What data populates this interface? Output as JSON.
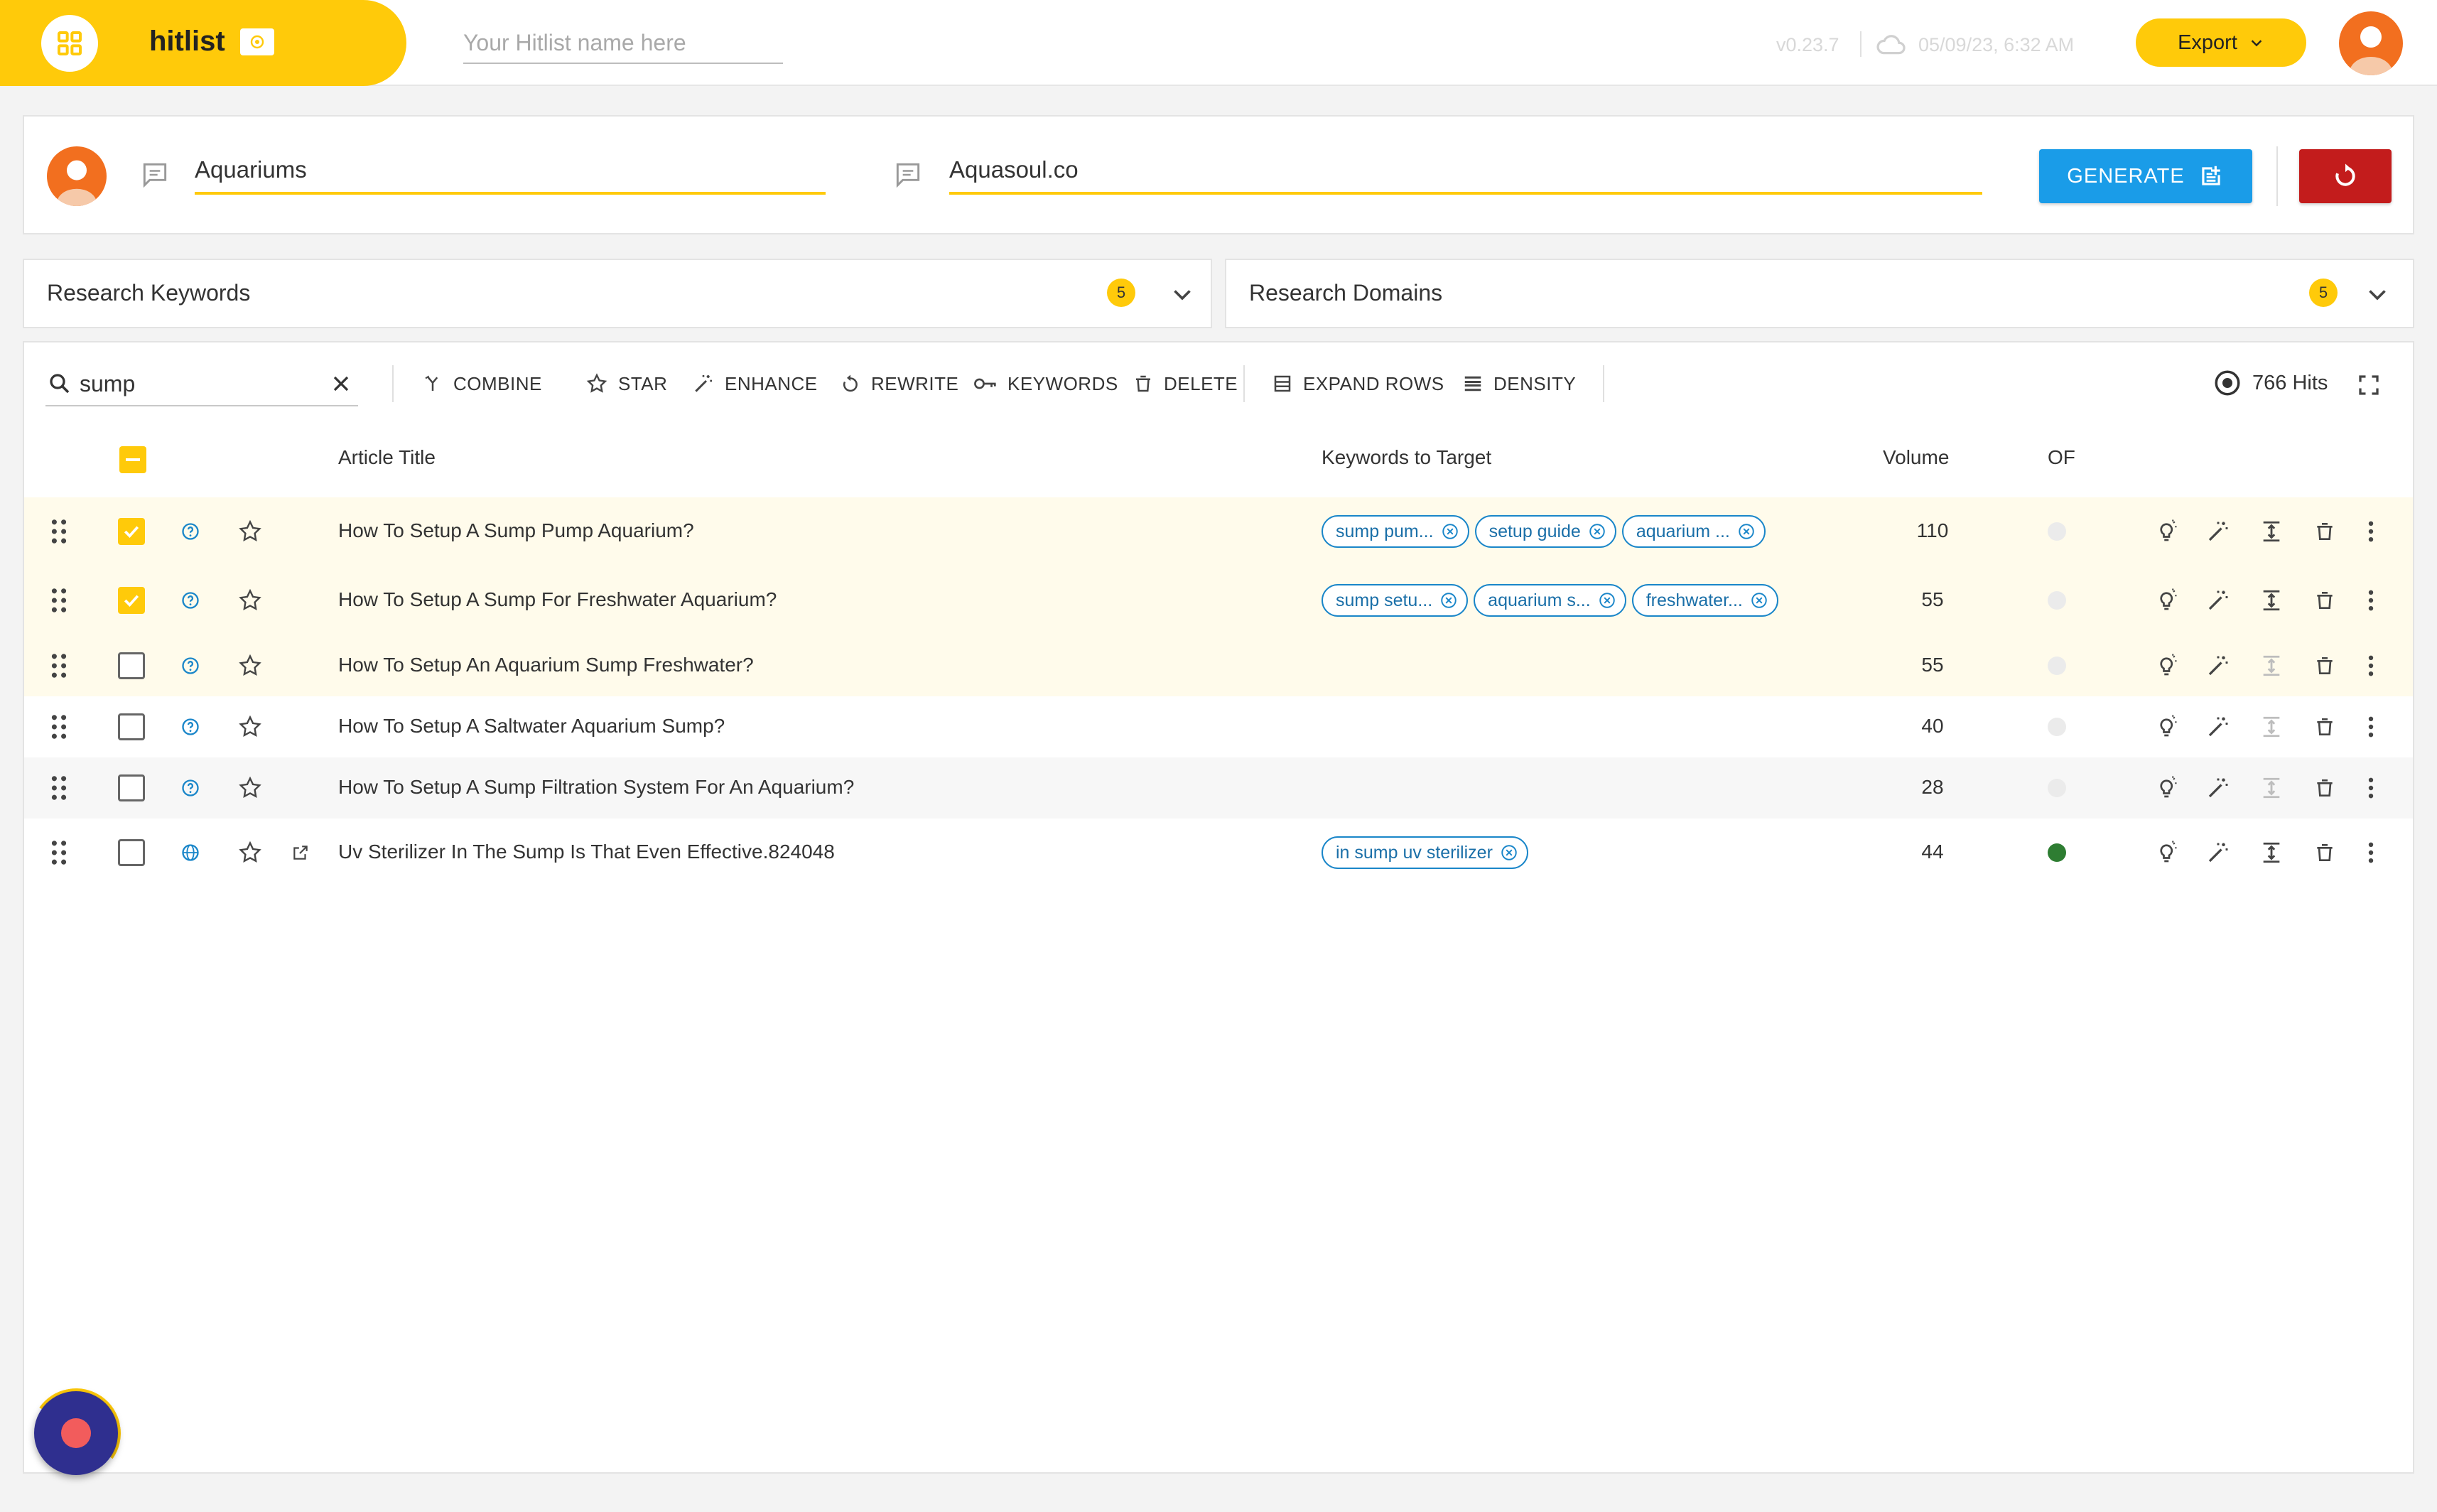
{
  "app": {
    "brand": "hitlist",
    "hitlist_name_placeholder": "Your Hitlist name here",
    "version": "v0.23.7",
    "saved_at": "05/09/23, 6:32 AM",
    "export_label": "Export"
  },
  "inputs": {
    "topic": "Aquariums",
    "domain": "Aquasoul.co",
    "generate_label": "GENERATE"
  },
  "panels": {
    "keywords": {
      "title": "Research Keywords",
      "count": "5"
    },
    "domains": {
      "title": "Research Domains",
      "count": "5"
    }
  },
  "toolbar": {
    "search_value": "sump",
    "combine": "COMBINE",
    "star": "STAR",
    "enhance": "ENHANCE",
    "rewrite": "REWRITE",
    "keywords": "KEYWORDS",
    "delete": "DELETE",
    "expand_rows": "EXPAND ROWS",
    "density": "DENSITY",
    "hits": "766 Hits"
  },
  "table": {
    "headers": {
      "title": "Article Title",
      "keywords": "Keywords to Target",
      "volume": "Volume",
      "of": "OF"
    },
    "rows": [
      {
        "title": "How To Setup A Sump Pump Aquarium?",
        "checked": true,
        "icon": "question-icon",
        "keywords": [
          "sump pum...",
          "setup guide",
          "aquarium ..."
        ],
        "volume": "110",
        "of": false
      },
      {
        "title": "How To Setup A Sump For Freshwater Aquarium?",
        "checked": true,
        "icon": "question-icon",
        "keywords": [
          "sump setu...",
          "aquarium s...",
          "freshwater..."
        ],
        "volume": "55",
        "of": false
      },
      {
        "title": "How To Setup An Aquarium Sump Freshwater?",
        "checked": false,
        "icon": "question-icon",
        "keywords": [],
        "volume": "55",
        "of": false
      },
      {
        "title": "How To Setup A Saltwater Aquarium Sump?",
        "checked": false,
        "icon": "question-icon",
        "keywords": [],
        "volume": "40",
        "of": false
      },
      {
        "title": "How To Setup A Sump Filtration System For An Aquarium?",
        "checked": false,
        "icon": "question-icon",
        "keywords": [],
        "volume": "28",
        "of": false
      },
      {
        "title": "Uv Sterilizer In The Sump Is That Even Effective.824048",
        "checked": false,
        "icon": "globe-icon",
        "keywords": [
          "in sump uv sterilizer"
        ],
        "volume": "44",
        "of": true
      }
    ]
  },
  "colors": {
    "brand_yellow": "#FFCA0A",
    "generate_blue": "#1A9CE8",
    "reset_red": "#C31C1C",
    "chip_blue": "#1A86C9",
    "of_green": "#2E7D32",
    "highlight_row": "#FFFBEB",
    "alt_row": "#F7F7F7"
  }
}
